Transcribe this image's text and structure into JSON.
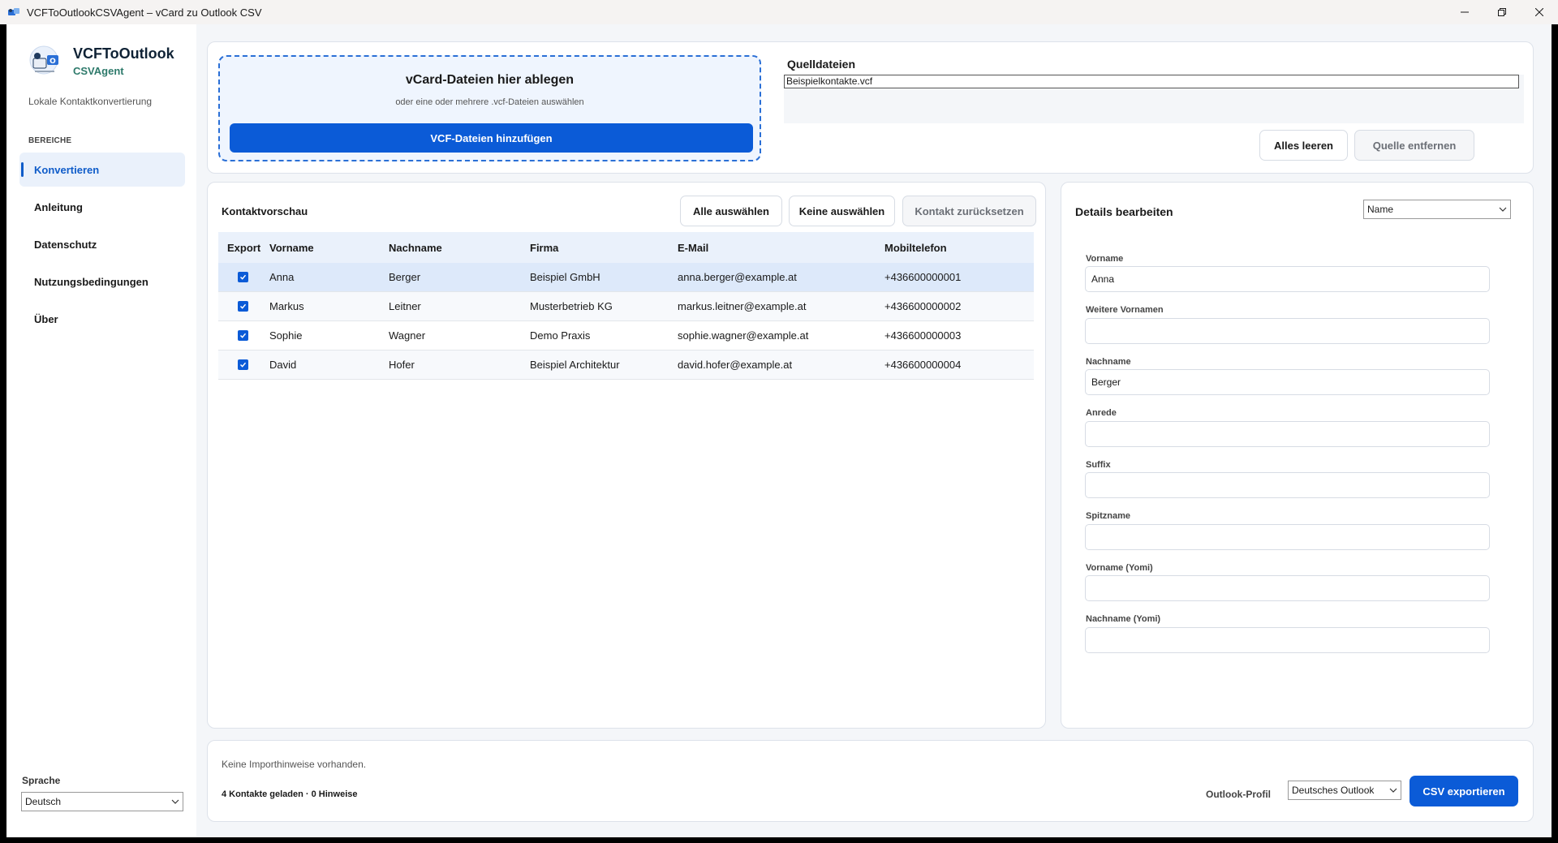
{
  "window": {
    "title": "VCFToOutlookCSVAgent – vCard zu Outlook CSV",
    "controls": {
      "minimize_icon": "minimize-icon",
      "restore_icon": "restore-icon",
      "close_icon": "close-icon"
    }
  },
  "sidebar": {
    "brand_name": "VCFToOutlook",
    "brand_sub": "CSVAgent",
    "tagline": "Lokale Kontaktkonvertierung",
    "section_label": "BEREICHE",
    "items": [
      {
        "label": "Konvertieren",
        "active": true
      },
      {
        "label": "Anleitung",
        "active": false
      },
      {
        "label": "Datenschutz",
        "active": false
      },
      {
        "label": "Nutzungsbedingungen",
        "active": false
      },
      {
        "label": "Über",
        "active": false
      }
    ],
    "language_label": "Sprache",
    "language_value": "Deutsch"
  },
  "import": {
    "drop_title": "vCard-Dateien hier ablegen",
    "drop_sub": "oder eine oder mehrere .vcf-Dateien auswählen",
    "add_button": "VCF-Dateien hinzufügen",
    "sources_title": "Quelldateien",
    "sources": [
      "Beispielkontakte.vcf"
    ],
    "clear_all": "Alles leeren",
    "remove_source": "Quelle entfernen"
  },
  "preview": {
    "title": "Kontaktvorschau",
    "select_all": "Alle auswählen",
    "select_none": "Keine auswählen",
    "reset_contact": "Kontakt zurücksetzen",
    "columns": [
      "Export",
      "Vorname",
      "Nachname",
      "Firma",
      "E-Mail",
      "Mobiltelefon"
    ],
    "rows": [
      {
        "export": true,
        "first": "Anna",
        "last": "Berger",
        "company": "Beispiel GmbH",
        "email": "anna.berger@example.at",
        "mobile": "+436600000001"
      },
      {
        "export": true,
        "first": "Markus",
        "last": "Leitner",
        "company": "Musterbetrieb KG",
        "email": "markus.leitner@example.at",
        "mobile": "+436600000002"
      },
      {
        "export": true,
        "first": "Sophie",
        "last": "Wagner",
        "company": "Demo Praxis",
        "email": "sophie.wagner@example.at",
        "mobile": "+436600000003"
      },
      {
        "export": true,
        "first": "David",
        "last": "Hofer",
        "company": "Beispiel Architektur",
        "email": "david.hofer@example.at",
        "mobile": "+436600000004"
      }
    ]
  },
  "details": {
    "title": "Details bearbeiten",
    "group_value": "Name",
    "fields": [
      {
        "label": "Vorname",
        "value": "Anna"
      },
      {
        "label": "Weitere Vornamen",
        "value": ""
      },
      {
        "label": "Nachname",
        "value": "Berger"
      },
      {
        "label": "Anrede",
        "value": ""
      },
      {
        "label": "Suffix",
        "value": ""
      },
      {
        "label": "Spitzname",
        "value": ""
      },
      {
        "label": "Vorname (Yomi)",
        "value": ""
      },
      {
        "label": "Nachname (Yomi)",
        "value": ""
      }
    ]
  },
  "footer": {
    "hint": "Keine Importhinweise vorhanden.",
    "status": "4 Kontakte geladen · 0 Hinweise",
    "profile_label": "Outlook-Profil",
    "profile_value": "Deutsches Outlook",
    "export_button": "CSV exportieren"
  },
  "colors": {
    "accent": "#0b5bd7",
    "nav_active_bg": "#eaf1fb",
    "brand_sub": "#2e7a6b",
    "background": "#f4f6f9"
  }
}
